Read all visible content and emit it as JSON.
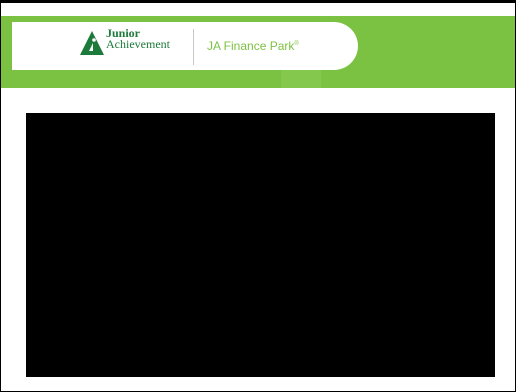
{
  "header": {
    "brand_line1": "Junior",
    "brand_line2": "Achievement",
    "product_name": "JA Finance Park",
    "trademark": "®",
    "brand_green": "#1c7a3a",
    "accent_green": "#7cc242"
  },
  "icons": {
    "logo": "ja-logo-icon"
  }
}
